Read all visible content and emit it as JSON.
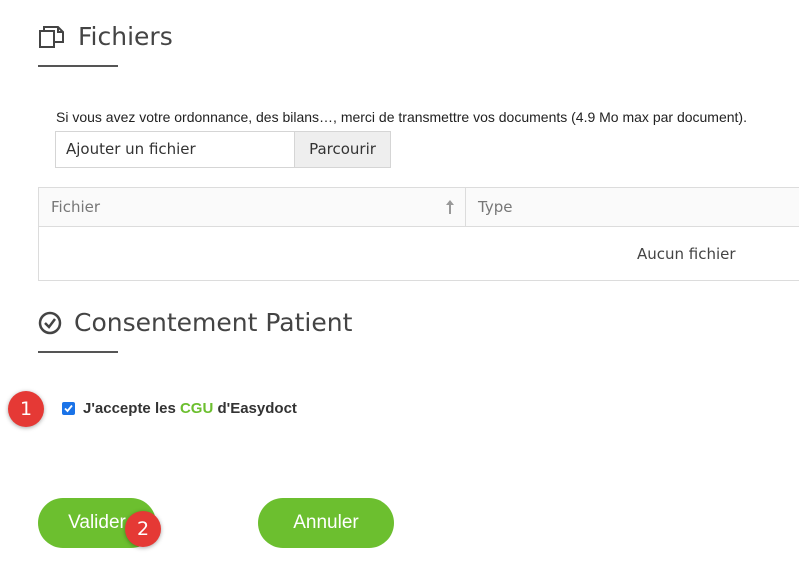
{
  "files_section": {
    "title": "Fichiers",
    "icon": "files-icon",
    "instruction": "Si vous avez votre ordonnance, des bilans…, merci de transmettre vos documents (4.9 Mo max par document).",
    "file_input": {
      "placeholder": "Ajouter un fichier",
      "browse_label": "Parcourir"
    },
    "table": {
      "columns": [
        "Fichier",
        "Type"
      ],
      "sort_icon": "sort-up-arrow-icon",
      "empty_message": "Aucun fichier"
    }
  },
  "consent_section": {
    "title": "Consentement Patient",
    "icon": "check-circle-icon",
    "checkbox_checked": true,
    "label_prefix": "J'accepte les ",
    "label_link": "CGU",
    "label_suffix": " d'Easydoct"
  },
  "actions": {
    "validate_label": "Valider",
    "cancel_label": "Annuler"
  },
  "markers": [
    "1",
    "2"
  ],
  "colors": {
    "accent": "#6cbf2f",
    "marker": "#e53935",
    "checkbox": "#1a73e8"
  }
}
